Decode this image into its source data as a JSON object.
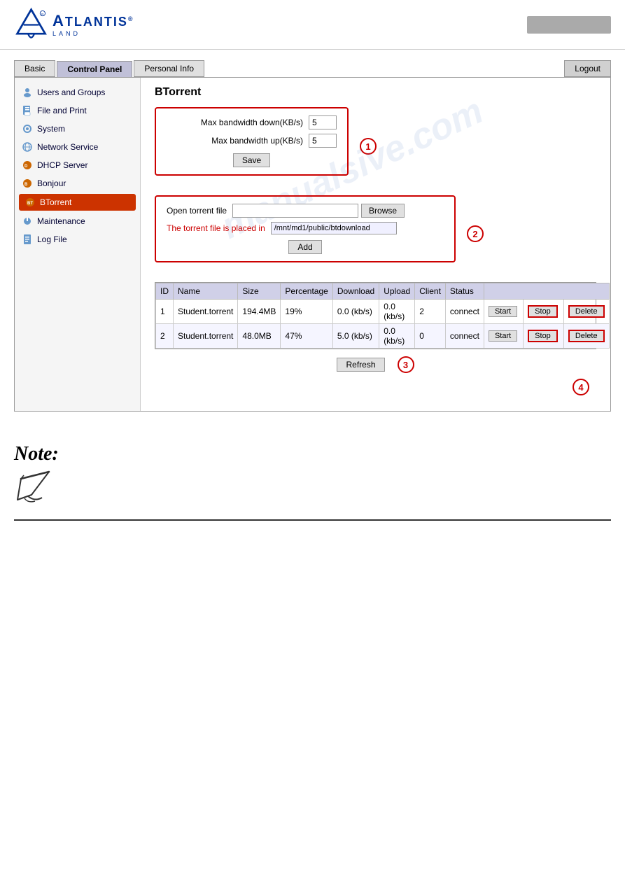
{
  "header": {
    "logo_text": "TLANTIS",
    "logo_sub": "AND",
    "right_box": ""
  },
  "nav": {
    "tabs": [
      "Basic",
      "Control Panel",
      "Personal Info"
    ],
    "active_tab": "Control Panel",
    "logout_label": "Logout"
  },
  "sidebar": {
    "items": [
      {
        "label": "Users and Groups",
        "icon": "users-icon"
      },
      {
        "label": "File and Print",
        "icon": "file-icon"
      },
      {
        "label": "System",
        "icon": "system-icon"
      },
      {
        "label": "Network Service",
        "icon": "network-icon"
      },
      {
        "label": "DHCP Server",
        "icon": "dhcp-icon"
      },
      {
        "label": "Bonjour",
        "icon": "bonjour-icon"
      },
      {
        "label": "BTorrent",
        "icon": "btorrent-icon"
      },
      {
        "label": "Maintenance",
        "icon": "maintenance-icon"
      },
      {
        "label": "Log File",
        "icon": "logfile-icon"
      }
    ],
    "active_item": "BTorrent"
  },
  "page": {
    "title": "BTorrent",
    "bandwidth": {
      "down_label": "Max bandwidth down(KB/s)",
      "down_value": "5",
      "up_label": "Max bandwidth up(KB/s)",
      "up_value": "5",
      "save_label": "Save"
    },
    "torrent_file": {
      "open_label": "Open torrent file",
      "browse_label": "Browse",
      "placed_label": "The torrent file is placed in",
      "placed_path": "/mnt/md1/public/btdownload",
      "add_label": "Add"
    },
    "table": {
      "columns": [
        "ID",
        "Name",
        "Size",
        "Percentage",
        "Download",
        "Upload",
        "Client",
        "Status"
      ],
      "rows": [
        {
          "id": "1",
          "name": "Student.torrent",
          "size": "194.4MB",
          "percentage": "19%",
          "download": "0.0 (kb/s)",
          "upload": "0.0 (kb/s)",
          "client": "2",
          "status": "connect"
        },
        {
          "id": "2",
          "name": "Student.torrent",
          "size": "48.0MB",
          "percentage": "47%",
          "download": "5.0 (kb/s)",
          "upload": "0.0 (kb/s)",
          "client": "0",
          "status": "connect"
        }
      ],
      "btn_start": "Start",
      "btn_stop": "Stop",
      "btn_delete": "Delete"
    },
    "refresh_label": "Refresh"
  },
  "note": {
    "title": "Note:"
  },
  "annotations": {
    "one": "1",
    "two": "2",
    "three": "3",
    "four": "4"
  }
}
